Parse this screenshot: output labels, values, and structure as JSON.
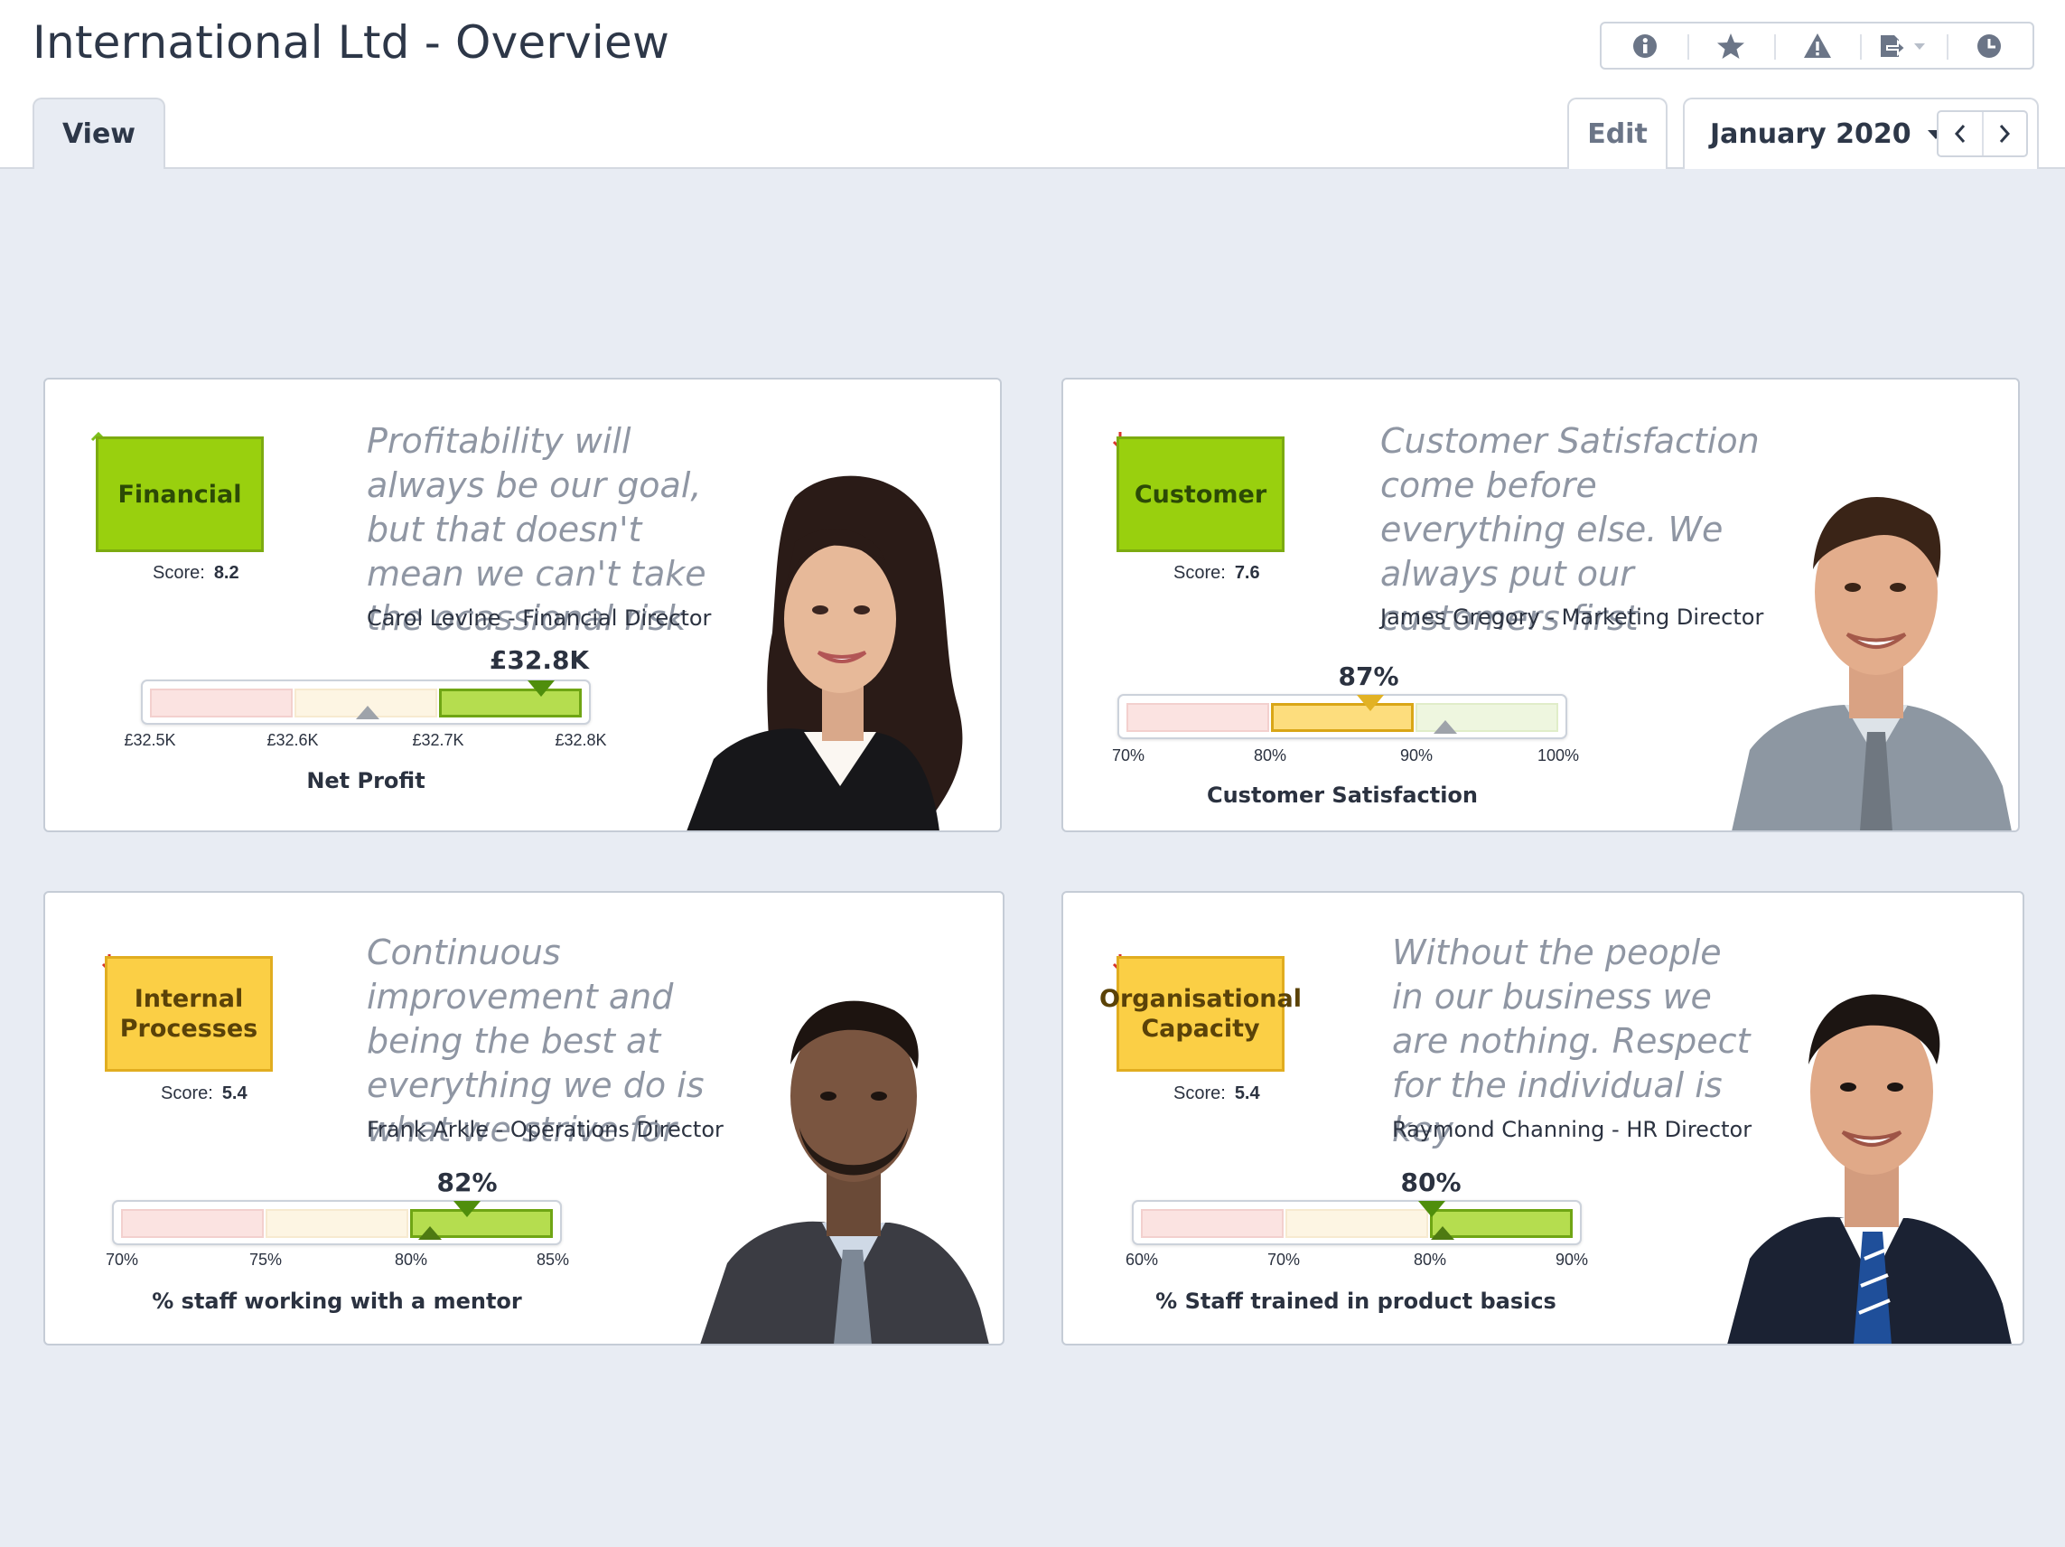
{
  "header": {
    "title": "International Ltd - Overview"
  },
  "toolbar": {
    "icons": [
      "info-icon",
      "star-icon",
      "warning-icon",
      "export-icon",
      "history-icon"
    ]
  },
  "tabs": {
    "view": "View",
    "edit": "Edit",
    "period": "January 2020"
  },
  "colors": {
    "green": "#99d00e",
    "amber": "#fbcf45",
    "trend_up": "#7cbf1a",
    "trend_down": "#d7342a"
  },
  "cards": [
    {
      "category": "Financial",
      "status": "green",
      "trend": "up",
      "score_label": "Score:",
      "score": "8.2",
      "quote": "Profitability will always be our goal, but that doesn't mean we can't take the ocassional risk",
      "author": "Carol Levine - Financial Director",
      "value": "£32.8K",
      "ticks": [
        "£32.5K",
        "£32.6K",
        "£32.7K",
        "£32.8K"
      ],
      "metric": "Net Profit",
      "active_band": 3,
      "target": "£32.7K"
    },
    {
      "category": "Customer",
      "status": "green",
      "trend": "down",
      "score_label": "Score:",
      "score": "7.6",
      "quote": "Customer Satisfaction come before everything else. We always put our customers first",
      "author": "James Gregory - Marketing Director",
      "value": "87%",
      "ticks": [
        "70%",
        "80%",
        "90%",
        "100%"
      ],
      "metric": "Customer Satisfaction",
      "active_band": 2,
      "target": "90%"
    },
    {
      "category": "Internal Processes",
      "status": "amber",
      "trend": "down",
      "score_label": "Score:",
      "score": "5.4",
      "quote": "Continuous improvement and being the best at everything we do is what we strive for",
      "author": "Frank Arkle - Operations Director",
      "value": "82%",
      "ticks": [
        "70%",
        "75%",
        "80%",
        "85%"
      ],
      "metric": "% staff working with a mentor",
      "active_band": 3,
      "target": "80%"
    },
    {
      "category": "Organisational Capacity",
      "status": "amber",
      "trend": "down",
      "score_label": "Score:",
      "score": "5.4",
      "quote": "Without the people in our business we are nothing.  Respect for the individual is key",
      "author": "Raymond Channing - HR Director",
      "value": "80%",
      "ticks": [
        "60%",
        "70%",
        "80%",
        "90%"
      ],
      "metric": "% Staff trained in product basics",
      "active_band": 3,
      "target": "80%"
    }
  ]
}
